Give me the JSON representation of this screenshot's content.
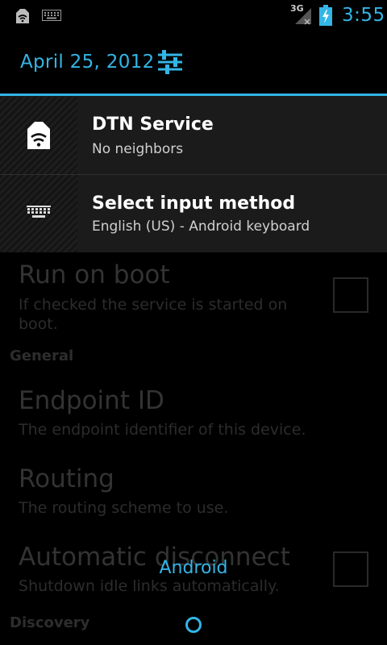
{
  "status_bar": {
    "network": "3G",
    "time": "3:55",
    "icons": [
      "dtn-notification-icon",
      "keyboard-icon",
      "signal-icon",
      "battery-charging-icon"
    ]
  },
  "header": {
    "date": "April 25, 2012",
    "settings_icon": "quick-settings-icon"
  },
  "notifications": [
    {
      "title": "DTN Service",
      "text": "No neighbors",
      "icon": "dtn-icon"
    },
    {
      "title": "Select input method",
      "text": "English (US) - Android keyboard",
      "icon": "keyboard-icon"
    }
  ],
  "preferences": {
    "run_on_boot": {
      "title": "Run on boot",
      "summary": "If checked the service is started on boot."
    },
    "category_general": "General",
    "endpoint": {
      "title": "Endpoint ID",
      "summary": "The endpoint identifier of this device."
    },
    "routing": {
      "title": "Routing",
      "summary": "The routing scheme to use."
    },
    "auto_disconnect": {
      "title": "Automatic disconnect",
      "summary": "Shutdown idle links automatically."
    },
    "category_discovery": "Discovery"
  },
  "toast": {
    "text": "Android"
  },
  "colors": {
    "accent": "#33b5e5",
    "background": "#000000",
    "notification_bg": "#1b1b1b"
  }
}
